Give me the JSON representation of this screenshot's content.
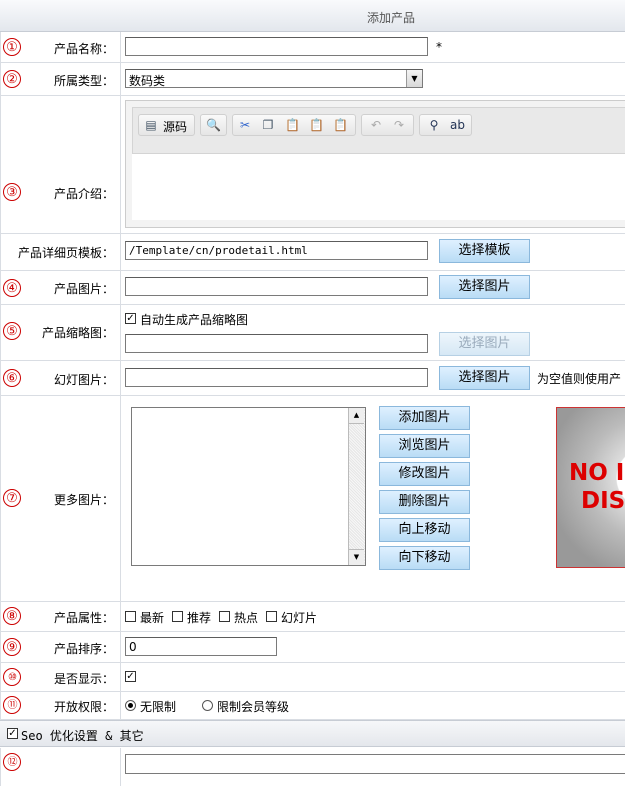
{
  "header": {
    "title": "添加产品"
  },
  "form": {
    "name": {
      "num": "①",
      "label": "产品名称：",
      "value": "",
      "required": "*"
    },
    "category": {
      "num": "②",
      "label": "所属类型：",
      "selected": "数码类"
    },
    "intro": {
      "num": "③",
      "label": "产品介绍：",
      "source_label": "源码"
    },
    "template": {
      "label": "产品详细页模板：",
      "value": "/Template/cn/prodetail.html",
      "button": "选择模板"
    },
    "image": {
      "num": "④",
      "label": "产品图片：",
      "value": "",
      "button": "选择图片"
    },
    "thumb": {
      "num": "⑤",
      "label": "产品缩略图：",
      "auto_label": "自动生成产品缩略图",
      "auto_checked": true,
      "value": "",
      "button": "选择图片"
    },
    "slide": {
      "num": "⑥",
      "label": "幻灯图片：",
      "value": "",
      "button": "选择图片",
      "hint": "为空值则使用产"
    },
    "more": {
      "num": "⑦",
      "label": "更多图片：",
      "buttons": [
        "添加图片",
        "浏览图片",
        "修改图片",
        "删除图片",
        "向上移动",
        "向下移动"
      ],
      "preview_line1": "NO I",
      "preview_line2": "DIS"
    },
    "attrs": {
      "num": "⑧",
      "label": "产品属性：",
      "options": [
        "最新",
        "推荐",
        "热点",
        "幻灯片"
      ]
    },
    "sort": {
      "num": "⑨",
      "label": "产品排序：",
      "value": "0"
    },
    "show": {
      "num": "⑩",
      "label": "是否显示：",
      "checked": true
    },
    "perm": {
      "num": "⑪",
      "label": "开放权限：",
      "options": [
        "无限制",
        "限制会员等级"
      ],
      "selected": "无限制"
    },
    "seo": {
      "label": "Seo 优化设置 & 其它",
      "checked": true
    },
    "last": {
      "num": "⑫"
    }
  }
}
